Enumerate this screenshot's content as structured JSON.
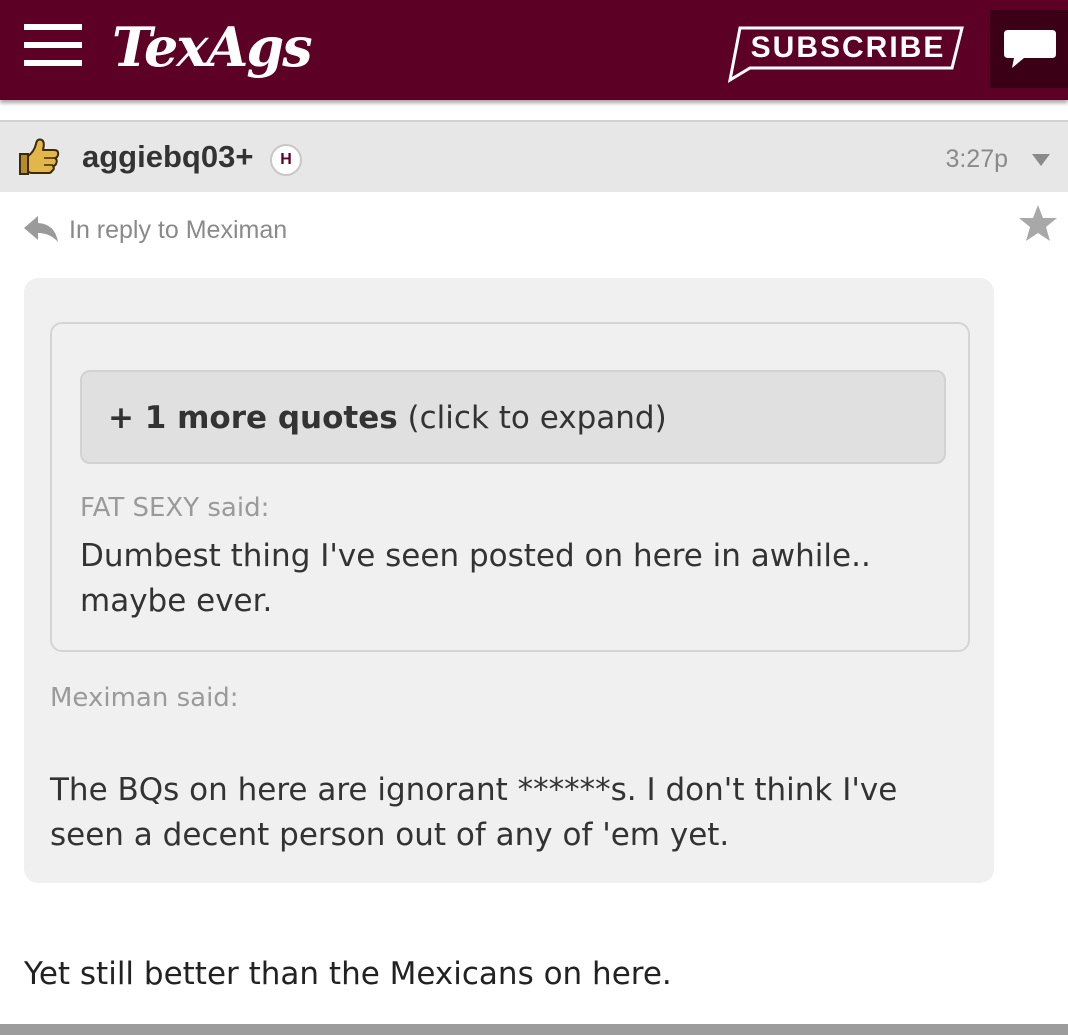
{
  "header": {
    "logo": "TexAgs",
    "subscribe_label": "SUBSCRIBE",
    "brand_color": "#5d0025",
    "icons": {
      "menu": "hamburger-menu-icon",
      "chat": "chat-bubble-icon"
    }
  },
  "post": {
    "username": "aggiebq03+",
    "badge": "H",
    "time": "3:27p",
    "in_reply_to": "In reply to Meximan",
    "icons": {
      "user": "thumbs-up-icon",
      "menu": "chevron-down-icon",
      "reply": "reply-arrow-icon",
      "favorite": "star-icon"
    },
    "quote": {
      "expand": {
        "bold": "+ 1 more quotes",
        "rest": " (click to expand)"
      },
      "inner": {
        "author_said": "FAT SEXY said:",
        "text": "Dumbest thing I've seen posted on here in awhile.. maybe ever."
      },
      "outer": {
        "author_said": "Meximan said:",
        "text": "The BQs on here are ignorant ******s. I don't think I've seen a decent person out of any of 'em yet."
      }
    },
    "body": "Yet still better than the Mexicans on here."
  }
}
